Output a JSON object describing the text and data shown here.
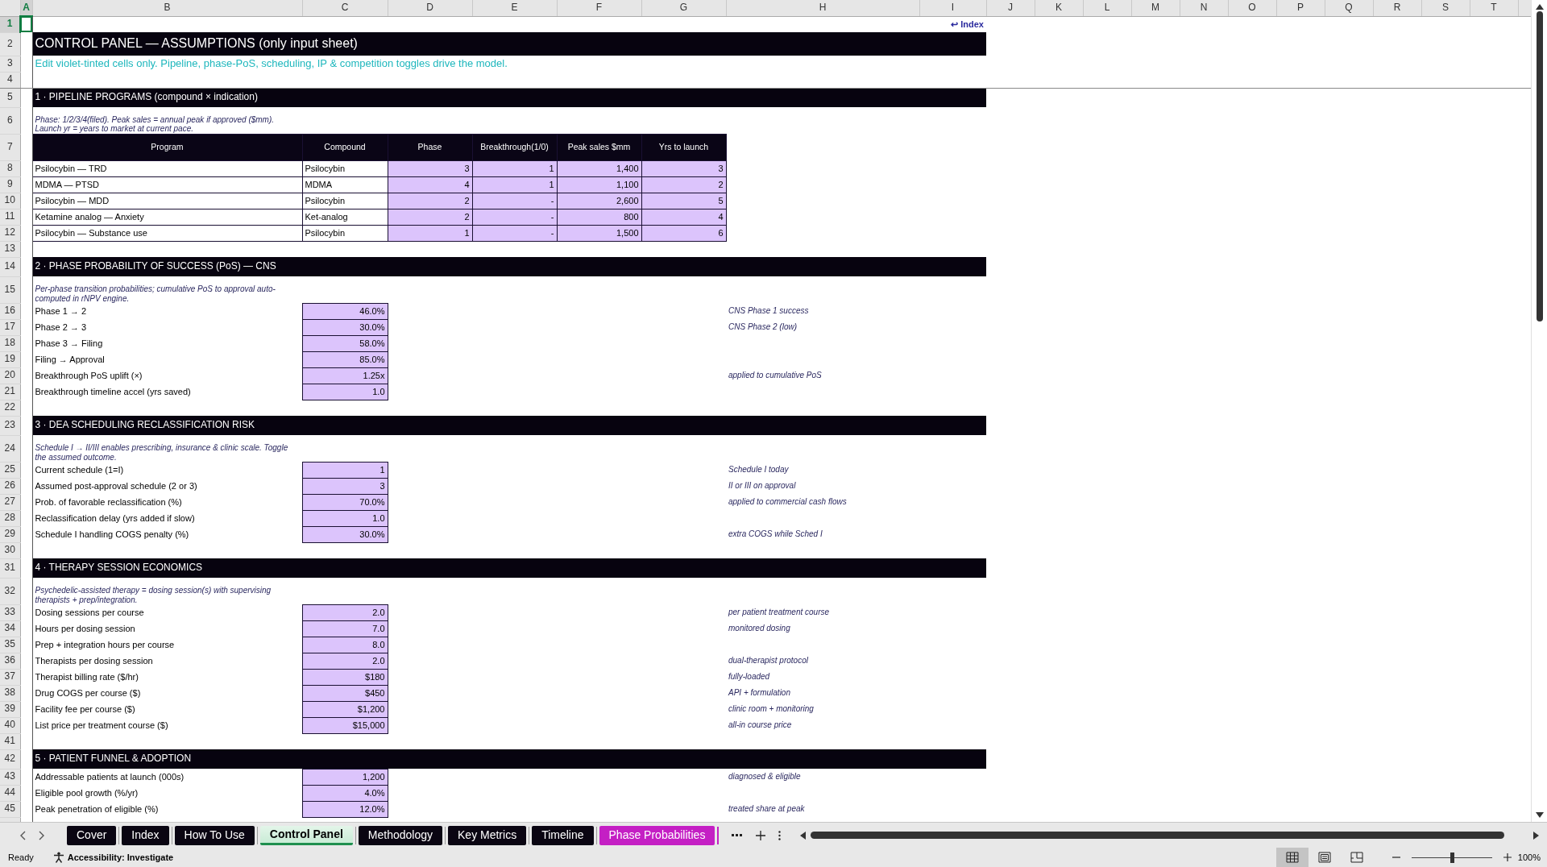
{
  "columns": [
    {
      "label": "A",
      "selected": true
    },
    {
      "label": "B",
      "selected": false
    },
    {
      "label": "C",
      "selected": false
    },
    {
      "label": "D",
      "selected": false
    },
    {
      "label": "E",
      "selected": false
    },
    {
      "label": "F",
      "selected": false
    },
    {
      "label": "G",
      "selected": false
    },
    {
      "label": "H",
      "selected": false
    },
    {
      "label": "I",
      "selected": false
    },
    {
      "label": "J",
      "selected": false
    },
    {
      "label": "K",
      "selected": false
    },
    {
      "label": "L",
      "selected": false
    },
    {
      "label": "M",
      "selected": false
    },
    {
      "label": "N",
      "selected": false
    },
    {
      "label": "O",
      "selected": false
    },
    {
      "label": "P",
      "selected": false
    },
    {
      "label": "Q",
      "selected": false
    },
    {
      "label": "R",
      "selected": false
    },
    {
      "label": "S",
      "selected": false
    },
    {
      "label": "T",
      "selected": false
    }
  ],
  "rows": [
    {
      "number": "1",
      "selected": true,
      "kind": "link",
      "text": "↩ Index"
    },
    {
      "number": "2",
      "selected": false,
      "kind": "title",
      "text": "CONTROL PANEL — ASSUMPTIONS (only input sheet)"
    },
    {
      "number": "3",
      "selected": false,
      "kind": "subtitle",
      "text": "Edit violet-tinted cells only. Pipeline, phase-PoS, scheduling, IP & competition toggles drive the model."
    },
    {
      "number": "4",
      "selected": false,
      "kind": "blank"
    },
    {
      "number": "5",
      "selected": false,
      "kind": "section",
      "text": "1 · PIPELINE PROGRAMS (compound × indication)"
    },
    {
      "number": "6",
      "selected": false,
      "kind": "note",
      "text": "Phase: 1/2/3/4(filed). Peak sales = annual peak if approved ($mm). Launch yr = years to market at current pace."
    },
    {
      "number": "7",
      "selected": false,
      "kind": "table_header",
      "cells": [
        "Program",
        "Compound",
        "Phase",
        "Breakthrough(1/0)",
        "Peak sales $mm",
        "Yrs to launch"
      ]
    },
    {
      "number": "8",
      "selected": false,
      "kind": "table_row",
      "cells": [
        "Psilocybin — TRD",
        "Psilocybin",
        "3",
        "1",
        "1,400",
        "3"
      ]
    },
    {
      "number": "9",
      "selected": false,
      "kind": "table_row",
      "cells": [
        "MDMA — PTSD",
        "MDMA",
        "4",
        "1",
        "1,100",
        "2"
      ]
    },
    {
      "number": "10",
      "selected": false,
      "kind": "table_row",
      "cells": [
        "Psilocybin — MDD",
        "Psilocybin",
        "2",
        "-",
        "2,600",
        "5"
      ]
    },
    {
      "number": "11",
      "selected": false,
      "kind": "table_row",
      "cells": [
        "Ketamine analog — Anxiety",
        "Ket-analog",
        "2",
        "-",
        "800",
        "4"
      ]
    },
    {
      "number": "12",
      "selected": false,
      "kind": "table_row",
      "cells": [
        "Psilocybin — Substance use",
        "Psilocybin",
        "1",
        "-",
        "1,500",
        "6"
      ]
    },
    {
      "number": "13",
      "selected": false,
      "kind": "blank"
    },
    {
      "number": "14",
      "selected": false,
      "kind": "section",
      "text": "2 · PHASE PROBABILITY OF SUCCESS (PoS) — CNS"
    },
    {
      "number": "15",
      "selected": false,
      "kind": "note",
      "text": "Per-phase transition probabilities; cumulative PoS to approval auto-computed in rNPV engine."
    },
    {
      "number": "16",
      "selected": false,
      "kind": "input",
      "label": "Phase 1 → 2",
      "value": "46.0%",
      "note": "CNS Phase 1 success"
    },
    {
      "number": "17",
      "selected": false,
      "kind": "input",
      "label": "Phase 2 → 3",
      "value": "30.0%",
      "note": "CNS Phase 2 (low)"
    },
    {
      "number": "18",
      "selected": false,
      "kind": "input",
      "label": "Phase 3 → Filing",
      "value": "58.0%"
    },
    {
      "number": "19",
      "selected": false,
      "kind": "input",
      "label": "Filing → Approval",
      "value": "85.0%"
    },
    {
      "number": "20",
      "selected": false,
      "kind": "input",
      "label": "Breakthrough PoS uplift (×)",
      "value": "1.25x",
      "note": "applied to cumulative PoS"
    },
    {
      "number": "21",
      "selected": false,
      "kind": "input",
      "label": "Breakthrough timeline accel (yrs saved)",
      "value": "1.0"
    },
    {
      "number": "22",
      "selected": false,
      "kind": "blank"
    },
    {
      "number": "23",
      "selected": false,
      "kind": "section",
      "text": "3 · DEA SCHEDULING RECLASSIFICATION RISK"
    },
    {
      "number": "24",
      "selected": false,
      "kind": "note",
      "text": "Schedule I → II/III enables prescribing, insurance & clinic scale. Toggle the assumed outcome."
    },
    {
      "number": "25",
      "selected": false,
      "kind": "input",
      "label": "Current schedule (1=I)",
      "value": "1",
      "note": "Schedule I today"
    },
    {
      "number": "26",
      "selected": false,
      "kind": "input",
      "label": "Assumed post-approval schedule (2 or 3)",
      "value": "3",
      "note": "II or III on approval"
    },
    {
      "number": "27",
      "selected": false,
      "kind": "input",
      "label": "Prob. of favorable reclassification (%)",
      "value": "70.0%",
      "note": "applied to commercial cash flows"
    },
    {
      "number": "28",
      "selected": false,
      "kind": "input",
      "label": "Reclassification delay (yrs added if slow)",
      "value": "1.0"
    },
    {
      "number": "29",
      "selected": false,
      "kind": "input",
      "label": "Schedule I handling COGS penalty (%)",
      "value": "30.0%",
      "note": "extra COGS while Sched I"
    },
    {
      "number": "30",
      "selected": false,
      "kind": "blank"
    },
    {
      "number": "31",
      "selected": false,
      "kind": "section",
      "text": "4 · THERAPY SESSION ECONOMICS"
    },
    {
      "number": "32",
      "selected": false,
      "kind": "note",
      "text": "Psychedelic-assisted therapy = dosing session(s) with supervising therapists + prep/integration."
    },
    {
      "number": "33",
      "selected": false,
      "kind": "input",
      "label": "Dosing sessions per course",
      "value": "2.0",
      "note": "per patient treatment course"
    },
    {
      "number": "34",
      "selected": false,
      "kind": "input",
      "label": "Hours per dosing session",
      "value": "7.0",
      "note": "monitored dosing"
    },
    {
      "number": "35",
      "selected": false,
      "kind": "input",
      "label": "Prep + integration hours per course",
      "value": "8.0"
    },
    {
      "number": "36",
      "selected": false,
      "kind": "input",
      "label": "Therapists per dosing session",
      "value": "2.0",
      "note": "dual-therapist protocol"
    },
    {
      "number": "37",
      "selected": false,
      "kind": "input",
      "label": "Therapist billing rate ($/hr)",
      "value": "$180",
      "note": "fully-loaded"
    },
    {
      "number": "38",
      "selected": false,
      "kind": "input",
      "label": "Drug COGS per course ($)",
      "value": "$450",
      "note": "API + formulation"
    },
    {
      "number": "39",
      "selected": false,
      "kind": "input",
      "label": "Facility fee per course ($)",
      "value": "$1,200",
      "note": "clinic room + monitoring"
    },
    {
      "number": "40",
      "selected": false,
      "kind": "input",
      "label": "List price per treatment course ($)",
      "value": "$15,000",
      "note": "all-in course price"
    },
    {
      "number": "41",
      "selected": false,
      "kind": "blank"
    },
    {
      "number": "42",
      "selected": false,
      "kind": "section",
      "text": "5 · PATIENT FUNNEL & ADOPTION"
    },
    {
      "number": "43",
      "selected": false,
      "kind": "input",
      "label": "Addressable patients at launch (000s)",
      "value": "1,200",
      "note": "diagnosed & eligible"
    },
    {
      "number": "44",
      "selected": false,
      "kind": "input",
      "label": "Eligible pool growth (%/yr)",
      "value": "4.0%"
    },
    {
      "number": "45",
      "selected": false,
      "kind": "input",
      "label": "Peak penetration of eligible (%)",
      "value": "12.0%",
      "note": "treated share at peak"
    }
  ],
  "tabs": [
    {
      "label": "Cover",
      "selected": false,
      "color": "#0a0512"
    },
    {
      "label": "Index",
      "selected": false,
      "color": "#0a0512"
    },
    {
      "label": "How To Use",
      "selected": false,
      "color": "#0a0512"
    },
    {
      "label": "Control Panel",
      "selected": true,
      "color": "#1e8f4e"
    },
    {
      "label": "Methodology",
      "selected": false,
      "color": "#0a0512"
    },
    {
      "label": "Key Metrics",
      "selected": false,
      "color": "#0a0512"
    },
    {
      "label": "Timeline",
      "selected": false,
      "color": "#0a0512"
    },
    {
      "label": "Phase Probabilities",
      "selected": false,
      "color": "#c41fc4"
    }
  ],
  "status_bar": {
    "status": "Ready",
    "accessibility": "Accessibility: Investigate",
    "view_buttons": [
      {
        "kind": "normal",
        "selected": true
      },
      {
        "kind": "page_layout",
        "selected": false
      },
      {
        "kind": "page_break",
        "selected": false
      }
    ],
    "zoom": {
      "level": 0.5,
      "reading": "100%"
    }
  }
}
